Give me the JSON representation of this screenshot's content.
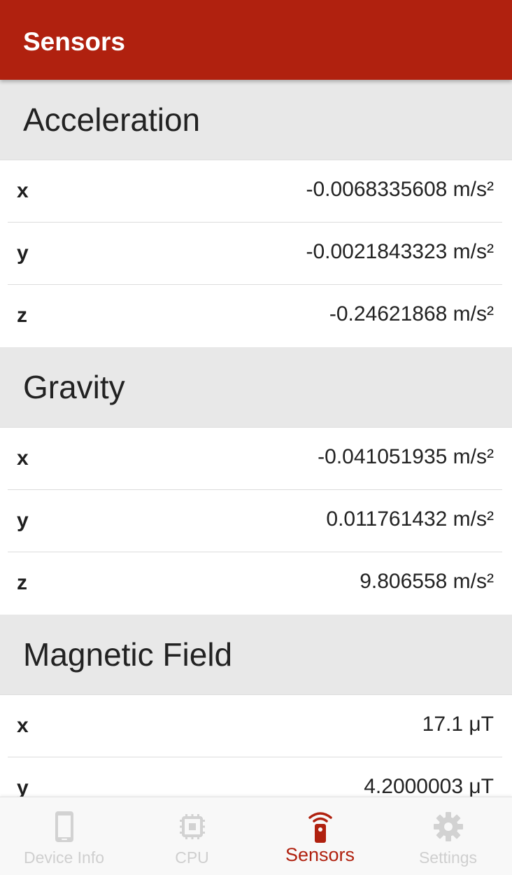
{
  "appbar": {
    "title": "Sensors"
  },
  "sections": [
    {
      "title": "Acceleration",
      "rows": [
        {
          "axis": "x",
          "value": "-0.0068335608 m/s²"
        },
        {
          "axis": "y",
          "value": "-0.0021843323 m/s²"
        },
        {
          "axis": "z",
          "value": "-0.24621868 m/s²"
        }
      ]
    },
    {
      "title": "Gravity",
      "rows": [
        {
          "axis": "x",
          "value": "-0.041051935 m/s²"
        },
        {
          "axis": "y",
          "value": "0.011761432 m/s²"
        },
        {
          "axis": "z",
          "value": "9.806558 m/s²"
        }
      ]
    },
    {
      "title": "Magnetic Field",
      "rows": [
        {
          "axis": "x",
          "value": "17.1 μT"
        },
        {
          "axis": "y",
          "value": "4.2000003 μT"
        }
      ]
    }
  ],
  "bottom_nav": {
    "items": [
      {
        "label": "Device Info",
        "icon": "phone-icon",
        "active": false
      },
      {
        "label": "CPU",
        "icon": "cpu-chip-icon",
        "active": false
      },
      {
        "label": "Sensors",
        "icon": "sensor-remote-icon",
        "active": true
      },
      {
        "label": "Settings",
        "icon": "gear-icon",
        "active": false
      }
    ]
  },
  "colors": {
    "primary": "#b0210f",
    "header_bg": "#e8e8e8",
    "inactive": "#cfcfcf"
  }
}
